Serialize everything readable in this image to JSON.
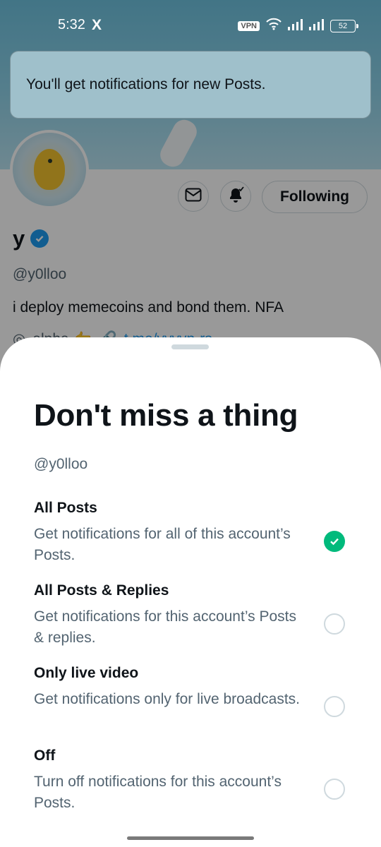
{
  "status_bar": {
    "time": "5:32",
    "app_icon": "X",
    "vpn": "VPN",
    "battery": "52"
  },
  "toast": {
    "message": "You'll get notifications for new Posts."
  },
  "profile": {
    "name": "y",
    "handle": "@y0lloo",
    "bio": "i deploy memecoins and bond them. NFA",
    "location": "alpha 👉",
    "link": "t.me/yyyyp-rs",
    "follow_button": "Following",
    "message_icon": "mail-icon",
    "bell_icon": "bell-icon"
  },
  "sheet": {
    "title": "Don't miss a thing",
    "handle": "@y0lloo",
    "options": [
      {
        "title": "All Posts",
        "desc": "Get notifications for all of this account’s Posts.",
        "selected": true
      },
      {
        "title": "All Posts & Replies",
        "desc": "Get notifications for this account’s Posts & replies.",
        "selected": false
      },
      {
        "title": "Only live video",
        "desc": "Get notifications only for live broadcasts.",
        "selected": false
      },
      {
        "title": "Off",
        "desc": "Turn off notifications for this account’s Posts.",
        "selected": false
      }
    ]
  },
  "colors": {
    "accent": "#1d9bf0",
    "selected": "#00ba7c",
    "secondary_text": "#536471"
  }
}
